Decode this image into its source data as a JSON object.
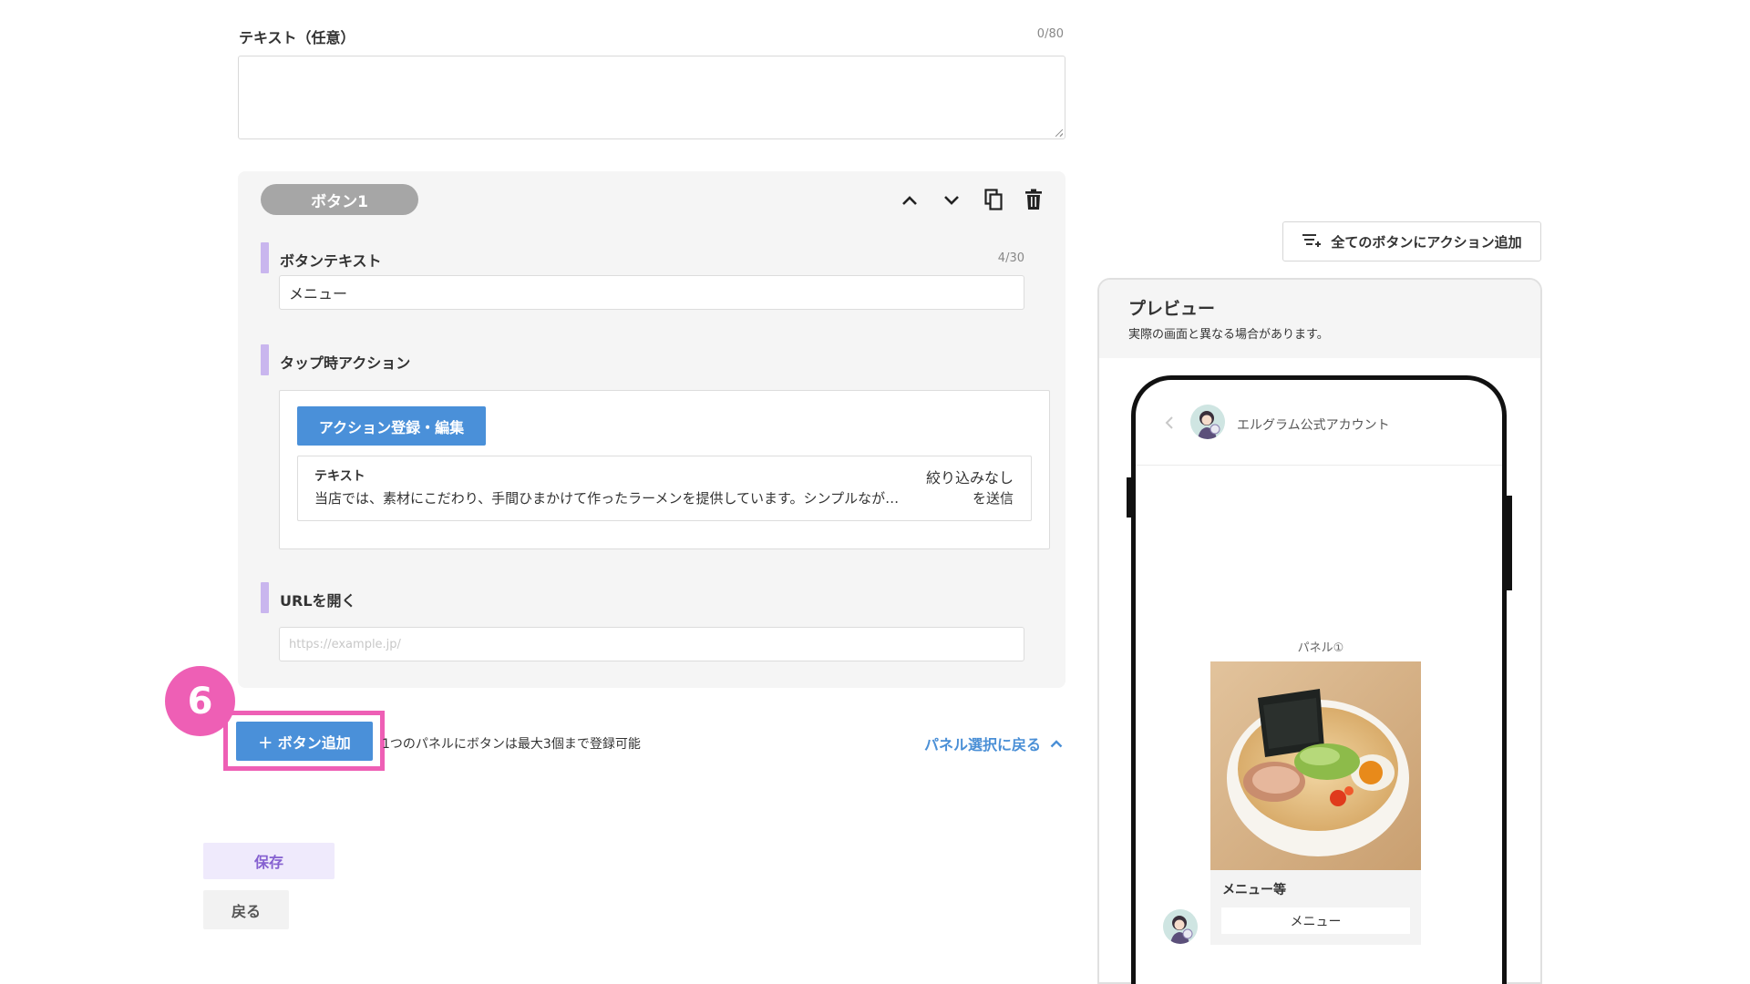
{
  "text_field": {
    "label": "テキスト（任意）",
    "counter": "0/80",
    "value": ""
  },
  "button_card": {
    "title": "ボタン1",
    "button_text": {
      "label": "ボタンテキスト",
      "counter": "4/30",
      "value": "メニュー"
    },
    "tap_action": {
      "label": "タップ時アクション",
      "register_button": "アクション登録・編集",
      "item": {
        "type": "テキスト",
        "filter": "絞り込みなし",
        "content": "当店では、素材にこだわり、手間ひまかけて作ったラーメンを提供しています。シンプルなが…",
        "suffix": "を送信"
      }
    },
    "url": {
      "label": "URLを開く",
      "placeholder": "https://example.jp/"
    }
  },
  "step_badge": "6",
  "add_button": "＋ ボタン追加",
  "add_note": "1つのパネルにボタンは最大3個まで登録可能",
  "back_to_panel": "パネル選択に戻る",
  "save_label": "保存",
  "back_label": "戻る",
  "preview": {
    "add_all_button": "全てのボタンにアクション追加",
    "title": "プレビュー",
    "subtitle": "実際の画面と異なる場合があります。",
    "account_name": "エルグラム公式アカウント",
    "panel_label": "パネル①",
    "card_title": "メニュー等",
    "card_button": "メニュー"
  },
  "colors": {
    "accent_pink": "#ee5fb5",
    "blue": "#4a90d9",
    "purple_bar": "#c9b6ee"
  }
}
